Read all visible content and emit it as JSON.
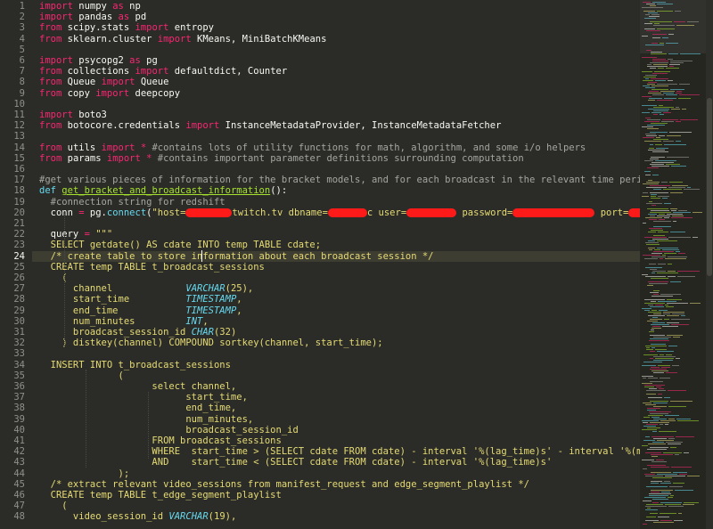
{
  "editor": {
    "cursor_line": 24,
    "lines": [
      {
        "n": "1",
        "tokens": [
          [
            "k",
            "import"
          ],
          [
            "n",
            " numpy "
          ],
          [
            "k",
            "as"
          ],
          [
            "n",
            " np"
          ]
        ]
      },
      {
        "n": "2",
        "tokens": [
          [
            "k",
            "import"
          ],
          [
            "n",
            " pandas "
          ],
          [
            "k",
            "as"
          ],
          [
            "n",
            " pd"
          ]
        ]
      },
      {
        "n": "3",
        "tokens": [
          [
            "k",
            "from"
          ],
          [
            "n",
            " scipy.stats "
          ],
          [
            "k",
            "import"
          ],
          [
            "n",
            " entropy"
          ]
        ]
      },
      {
        "n": "4",
        "tokens": [
          [
            "k",
            "from"
          ],
          [
            "n",
            " sklearn.cluster "
          ],
          [
            "k",
            "import"
          ],
          [
            "n",
            " KMeans, MiniBatchKMeans"
          ]
        ]
      },
      {
        "n": "5",
        "tokens": []
      },
      {
        "n": "6",
        "tokens": [
          [
            "k",
            "import"
          ],
          [
            "n",
            " psycopg2 "
          ],
          [
            "k",
            "as"
          ],
          [
            "n",
            " pg"
          ]
        ]
      },
      {
        "n": "7",
        "tokens": [
          [
            "k",
            "from"
          ],
          [
            "n",
            " collections "
          ],
          [
            "k",
            "import"
          ],
          [
            "n",
            " defaultdict, Counter"
          ]
        ]
      },
      {
        "n": "8",
        "tokens": [
          [
            "k",
            "from"
          ],
          [
            "n",
            " Queue "
          ],
          [
            "k",
            "import"
          ],
          [
            "n",
            " Queue"
          ]
        ]
      },
      {
        "n": "9",
        "tokens": [
          [
            "k",
            "from"
          ],
          [
            "n",
            " copy "
          ],
          [
            "k",
            "import"
          ],
          [
            "n",
            " deepcopy"
          ]
        ]
      },
      {
        "n": "10",
        "tokens": []
      },
      {
        "n": "11",
        "tokens": [
          [
            "k",
            "import"
          ],
          [
            "n",
            " boto3"
          ]
        ]
      },
      {
        "n": "12",
        "tokens": [
          [
            "k",
            "from"
          ],
          [
            "n",
            " botocore.credentials "
          ],
          [
            "k",
            "import"
          ],
          [
            "n",
            " InstanceMetadataProvider, InstanceMetadataFetcher"
          ]
        ]
      },
      {
        "n": "13",
        "tokens": []
      },
      {
        "n": "14",
        "tokens": [
          [
            "k",
            "from"
          ],
          [
            "n",
            " utils "
          ],
          [
            "k",
            "import"
          ],
          [
            "n",
            " "
          ],
          [
            "k",
            "*"
          ],
          [
            "n",
            " "
          ],
          [
            "c",
            "#contains lots of utility functions for math, algorithm, and some i/o helpers"
          ]
        ]
      },
      {
        "n": "15",
        "tokens": [
          [
            "k",
            "from"
          ],
          [
            "n",
            " params "
          ],
          [
            "k",
            "import"
          ],
          [
            "n",
            " "
          ],
          [
            "k",
            "*"
          ],
          [
            "n",
            " "
          ],
          [
            "c",
            "#contains important parameter definitions surrounding computation"
          ]
        ]
      },
      {
        "n": "16",
        "tokens": []
      },
      {
        "n": "17",
        "tokens": [
          [
            "c",
            "#get various pieces of information for the bracket models, and for each broadcast in the relevant time period, including"
          ]
        ]
      },
      {
        "n": "18",
        "tokens": [
          [
            "f",
            "def"
          ],
          [
            "n",
            " "
          ],
          [
            "fn",
            "get_bracket_and_broadcast_information"
          ],
          [
            "n",
            "():"
          ]
        ]
      },
      {
        "n": "19",
        "tokens": [
          [
            "c",
            "  #connection string for redshift"
          ]
        ]
      },
      {
        "n": "20",
        "tokens": [
          [
            "n",
            "  conn "
          ],
          [
            "k",
            "="
          ],
          [
            "n",
            " pg."
          ],
          [
            "f",
            "connect"
          ],
          [
            "n",
            "("
          ],
          [
            "s",
            "\"host="
          ],
          [
            "r",
            "52"
          ],
          [
            "s",
            "twitch.tv dbname="
          ],
          [
            "r",
            "44"
          ],
          [
            "s",
            "c user="
          ],
          [
            "r",
            "56"
          ],
          [
            "s",
            " password="
          ],
          [
            "r",
            "92"
          ],
          [
            "s",
            " port="
          ],
          [
            "r",
            "24"
          ],
          [
            "s",
            "\""
          ],
          [
            "n",
            ");"
          ]
        ]
      },
      {
        "n": "21",
        "tokens": []
      },
      {
        "n": "22",
        "tokens": [
          [
            "n",
            "  query "
          ],
          [
            "k",
            "="
          ],
          [
            "n",
            " "
          ],
          [
            "s",
            "\"\"\""
          ]
        ]
      },
      {
        "n": "23",
        "tokens": [
          [
            "s",
            "  SELECT getdate() AS cdate INTO temp TABLE cdate;"
          ]
        ]
      },
      {
        "n": "24",
        "tokens": [
          [
            "s",
            "  /* create table to store information about each broadcast session */"
          ]
        ]
      },
      {
        "n": "25",
        "tokens": [
          [
            "s",
            "  CREATE temp TABLE t_broadcast_sessions"
          ]
        ]
      },
      {
        "n": "26",
        "tokens": [
          [
            "s",
            "    ("
          ]
        ]
      },
      {
        "n": "27",
        "tokens": [
          [
            "s",
            "      channel             VARCHAR(25),"
          ]
        ]
      },
      {
        "n": "28",
        "tokens": [
          [
            "s",
            "      start_time          TIMESTAMP,"
          ]
        ]
      },
      {
        "n": "29",
        "tokens": [
          [
            "s",
            "      end_time            TIMESTAMP,"
          ]
        ]
      },
      {
        "n": "30",
        "tokens": [
          [
            "s",
            "      num_minutes         INT,"
          ]
        ]
      },
      {
        "n": "31",
        "tokens": [
          [
            "s",
            "      broadcast_session_id CHAR(32)"
          ]
        ]
      },
      {
        "n": "32",
        "tokens": [
          [
            "s",
            "    ) distkey(channel) COMPOUND sortkey(channel, start_time);"
          ]
        ]
      },
      {
        "n": "33",
        "tokens": []
      },
      {
        "n": "34",
        "tokens": [
          [
            "s",
            "  INSERT INTO t_broadcast_sessions"
          ]
        ]
      },
      {
        "n": "35",
        "tokens": [
          [
            "s",
            "              ("
          ]
        ]
      },
      {
        "n": "36",
        "tokens": [
          [
            "s",
            "                    select channel,"
          ]
        ]
      },
      {
        "n": "37",
        "tokens": [
          [
            "s",
            "                          start_time,"
          ]
        ]
      },
      {
        "n": "38",
        "tokens": [
          [
            "s",
            "                          end_time,"
          ]
        ]
      },
      {
        "n": "39",
        "tokens": [
          [
            "s",
            "                          num_minutes,"
          ]
        ]
      },
      {
        "n": "40",
        "tokens": [
          [
            "s",
            "                          broadcast_session_id"
          ]
        ]
      },
      {
        "n": "41",
        "tokens": [
          [
            "s",
            "                    FROM broadcast_sessions"
          ]
        ]
      },
      {
        "n": "42",
        "tokens": [
          [
            "s",
            "                    WHERE  start_time > (SELECT cdate FROM cdate) - interval '%(lag_time)s' - interval '%(model_build_t"
          ]
        ]
      },
      {
        "n": "43",
        "tokens": [
          [
            "s",
            "                    AND    start_time < (SELECT cdate FROM cdate) - interval '%(lag_time)s'"
          ]
        ]
      },
      {
        "n": "44",
        "tokens": [
          [
            "s",
            "              );"
          ]
        ]
      },
      {
        "n": "45",
        "tokens": [
          [
            "s",
            "  /* extract relevant video_sessions from manifest_request and edge_segment_playlist */"
          ]
        ]
      },
      {
        "n": "46",
        "tokens": [
          [
            "s",
            "  CREATE temp TABLE t_edge_segment_playlist"
          ]
        ]
      },
      {
        "n": "47",
        "tokens": [
          [
            "s",
            "    ("
          ]
        ]
      },
      {
        "n": "48",
        "tokens": [
          [
            "s",
            "      video_session_id VARCHAR(19),"
          ]
        ]
      }
    ]
  }
}
